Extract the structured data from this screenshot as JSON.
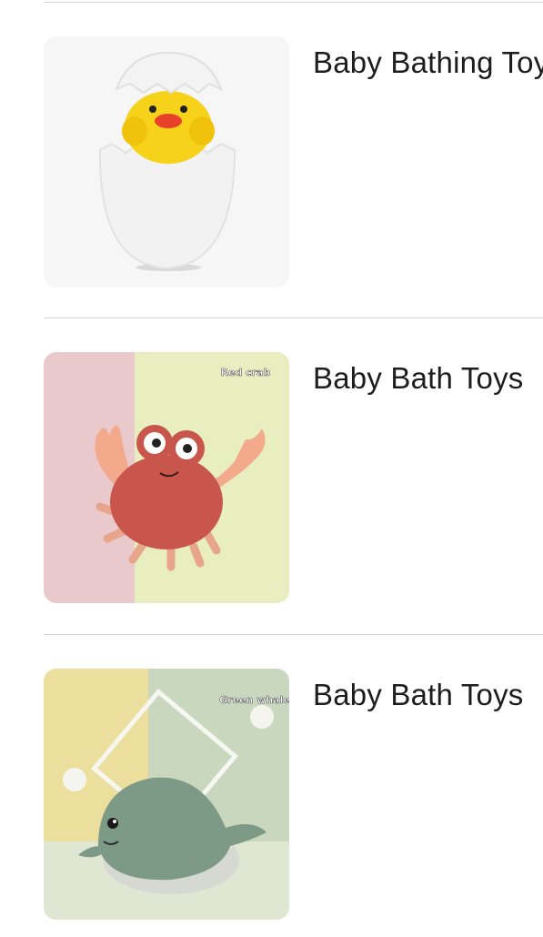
{
  "products": [
    {
      "title": "Baby Bathing Toys",
      "image_icon": "duck-egg-toy-icon",
      "badge": ""
    },
    {
      "title": "Baby Bath Toys",
      "image_icon": "crab-toy-icon",
      "badge": "Red crab"
    },
    {
      "title": "Baby Bath Toys",
      "image_icon": "whale-toy-icon",
      "badge": "Green whale"
    }
  ]
}
